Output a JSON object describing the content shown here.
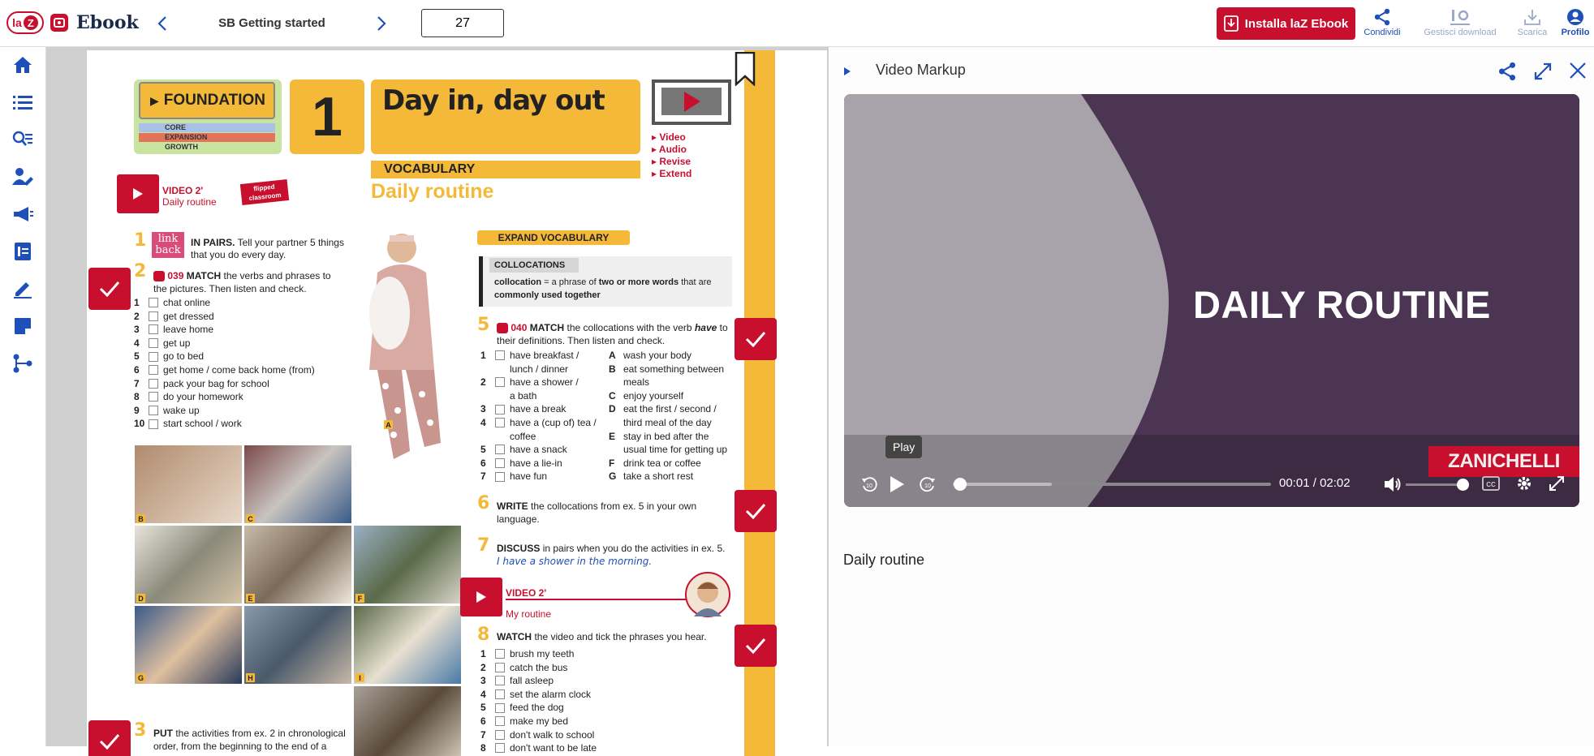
{
  "topbar": {
    "logo_laz": "la",
    "logo_z": "Z",
    "logo_ebook": "Ebook",
    "book_title": "SB Getting started",
    "page_number": "27",
    "install_label": "Installa laZ Ebook",
    "share_label": "Condividi",
    "downloads_label": "Gestisci download",
    "download_label": "Scarica",
    "profile_label": "Profilo"
  },
  "page": {
    "levels": {
      "foundation": "FOUNDATION",
      "core": "CORE",
      "expansion": "EXPANSION",
      "growth": "GROWTH"
    },
    "unit_number": "1",
    "unit_title": "Day in, day out",
    "media_links": [
      "▸ Video",
      "▸ Audio",
      "▸ Revise",
      "▸ Extend"
    ],
    "vocabulary_label": "VOCABULARY",
    "section_title": "Daily routine",
    "video_label": "VIDEO 2'",
    "video_caption": "Daily routine",
    "flipped_label": "flipped classroom",
    "link_back": "link back",
    "ex1_num": "1",
    "ex1_bold": "IN PAIRS.",
    "ex1_text": "Tell your partner 5 things that you do every day.",
    "ex2_num": "2",
    "ex2_track": "039",
    "ex2_bold": "MATCH",
    "ex2_text": "the verbs and phrases to the pictures. Then listen and check.",
    "ex2_items": [
      {
        "n": "1",
        "t": "chat online"
      },
      {
        "n": "2",
        "t": "get dressed"
      },
      {
        "n": "3",
        "t": "leave home"
      },
      {
        "n": "4",
        "t": "get up"
      },
      {
        "n": "5",
        "t": "go to bed"
      },
      {
        "n": "6",
        "t": "get home / come back home (from)"
      },
      {
        "n": "7",
        "t": "pack your bag for school"
      },
      {
        "n": "8",
        "t": "do your homework"
      },
      {
        "n": "9",
        "t": "wake up"
      },
      {
        "n": "10",
        "t": "start school / work"
      }
    ],
    "photo_labels": [
      "A",
      "B",
      "C",
      "D",
      "E",
      "F",
      "G",
      "H",
      "I"
    ],
    "expand_vocab": "EXPAND VOCABULARY",
    "collocations_head": "COLLOCATIONS",
    "collocation_word": "collocation",
    "collocation_def_1": "= a phrase of",
    "collocation_def_bold": "two or more words",
    "collocation_def_2": "that are",
    "collocation_def_3": "commonly used together",
    "ex5_num": "5",
    "ex5_track": "040",
    "ex5_bold": "MATCH",
    "ex5_text": "the collocations with the verb",
    "ex5_italic": "have",
    "ex5_text2": "to their definitions. Then listen and check.",
    "ex5_left": [
      {
        "n": "1",
        "t": "have breakfast /",
        "t2": "lunch / dinner"
      },
      {
        "n": "2",
        "t": "have a shower /",
        "t2": "a bath"
      },
      {
        "n": "3",
        "t": "have a break",
        "t2": ""
      },
      {
        "n": "4",
        "t": "have a (cup of) tea /",
        "t2": "coffee"
      },
      {
        "n": "5",
        "t": "have a snack",
        "t2": ""
      },
      {
        "n": "6",
        "t": "have a lie-in",
        "t2": ""
      },
      {
        "n": "7",
        "t": "have fun",
        "t2": ""
      }
    ],
    "ex5_right": [
      {
        "n": "A",
        "t": "wash your body"
      },
      {
        "n": "B",
        "t": "eat something between"
      },
      {
        "n": "",
        "t": "meals"
      },
      {
        "n": "C",
        "t": "enjoy yourself"
      },
      {
        "n": "D",
        "t": "eat the first / second /"
      },
      {
        "n": "",
        "t": "third meal of the day"
      },
      {
        "n": "E",
        "t": "stay in bed after the"
      },
      {
        "n": "",
        "t": "usual time for getting up"
      },
      {
        "n": "F",
        "t": "drink tea or coffee"
      },
      {
        "n": "G",
        "t": "take a short rest"
      }
    ],
    "ex6_num": "6",
    "ex6_bold": "WRITE",
    "ex6_text": "the collocations from ex. 5 in your own language.",
    "ex7_num": "7",
    "ex7_bold": "DISCUSS",
    "ex7_text": "in pairs when you do the activities in ex. 5.",
    "ex7_example": "I have a shower in the morning.",
    "video2_label": "VIDEO 2'",
    "video2_caption": "My routine",
    "ex8_num": "8",
    "ex8_bold": "WATCH",
    "ex8_text": "the video and tick the phrases you hear.",
    "ex8_items": [
      {
        "n": "1",
        "t": "brush my teeth"
      },
      {
        "n": "2",
        "t": "catch the bus"
      },
      {
        "n": "3",
        "t": "fall asleep"
      },
      {
        "n": "4",
        "t": "set the alarm clock"
      },
      {
        "n": "5",
        "t": "feed the dog"
      },
      {
        "n": "6",
        "t": "make my bed"
      },
      {
        "n": "7",
        "t": "don't walk to school"
      },
      {
        "n": "8",
        "t": "don't want to be late"
      }
    ],
    "ex3_num": "3",
    "ex3_bold": "PUT",
    "ex3_text": "the activities from ex. 2 in chronological",
    "ex3_text2": "order, from the beginning to the end of a"
  },
  "panel": {
    "title": "Video Markup",
    "video_title": "DAILY ROUTINE",
    "brand": "ZANICHELLI",
    "tooltip": "Play",
    "current_time": "00:01",
    "separator": "/",
    "duration": "02:02",
    "progress": 0.003,
    "buffered": 0.31,
    "volume": 0.95,
    "caption": "Daily routine"
  },
  "colors": {
    "accent": "#c8102e",
    "yellow": "#f5b93a",
    "link": "#1f4fb8"
  }
}
